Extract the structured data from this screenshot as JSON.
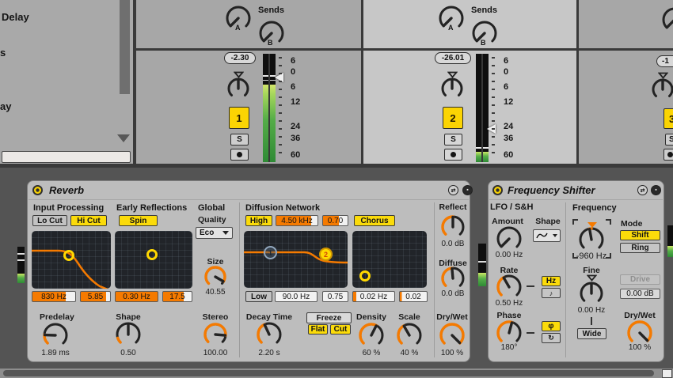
{
  "colors": {
    "accent_yellow": "#fbdb0a",
    "accent_orange": "#f57a00",
    "meter_green": "#55ad48",
    "selected_track": "#c7c7c7"
  },
  "browser": {
    "items": [
      "Delay",
      "s",
      "ay"
    ]
  },
  "mixer": {
    "sends_label": "Sends",
    "send_a": "A",
    "send_b": "B",
    "solo": "S",
    "meter_scale": [
      "6",
      "0",
      "6",
      "12",
      "24",
      "36",
      "60"
    ],
    "tracks": [
      {
        "number": "1",
        "volume": "-2.30"
      },
      {
        "number": "2",
        "volume": "-26.01"
      },
      {
        "number": "3",
        "volume": "-1"
      }
    ]
  },
  "reverb": {
    "title": "Reverb",
    "input_processing": {
      "label": "Input Processing",
      "lo_cut": "Lo Cut",
      "hi_cut": "Hi Cut",
      "freq": "830 Hz",
      "gain": "5.85"
    },
    "early_reflections": {
      "label": "Early Reflections",
      "spin": "Spin",
      "rate": "0.30 Hz",
      "amount": "17.5"
    },
    "global": {
      "label": "Global",
      "quality_label": "Quality",
      "quality": "Eco",
      "size_label": "Size",
      "size": "40.55",
      "stereo_label": "Stereo",
      "stereo": "100.00"
    },
    "diffusion": {
      "label": "Diffusion Network",
      "high": "High",
      "high_freq": "4.50 kHz",
      "high_gain": "0.70",
      "chorus": "Chorus",
      "marker1": "1",
      "marker2": "2",
      "low": "Low",
      "low_freq": "90.0 Hz",
      "low_gain": "0.75",
      "mod_rate": "0.02 Hz",
      "mod_amount": "0.02"
    },
    "reflect": {
      "label": "Reflect",
      "value": "0.0 dB"
    },
    "diffuse": {
      "label": "Diffuse",
      "value": "0.0 dB"
    },
    "predelay": {
      "label": "Predelay",
      "value": "1.89 ms"
    },
    "shape": {
      "label": "Shape",
      "value": "0.50"
    },
    "decay": {
      "label": "Decay Time",
      "value": "2.20 s"
    },
    "freeze": {
      "freeze": "Freeze",
      "flat": "Flat",
      "cut": "Cut"
    },
    "density": {
      "label": "Density",
      "value": "60 %"
    },
    "scale": {
      "label": "Scale",
      "value": "40 %"
    },
    "drywet": {
      "label": "Dry/Wet",
      "value": "100 %"
    }
  },
  "freq_shifter": {
    "title": "Frequency Shifter",
    "lfo": {
      "label": "LFO / S&H",
      "amount_label": "Amount",
      "amount": "0.00 Hz",
      "shape_label": "Shape",
      "rate_label": "Rate",
      "rate": "0.50 Hz",
      "hz": "Hz",
      "note_icon": "♪",
      "phase_label": "Phase",
      "phase": "180°",
      "phi": "φ",
      "spin_icon": "↻"
    },
    "frequency": {
      "label": "Frequency",
      "value": "-960 Hz",
      "fine_label": "Fine",
      "fine": "0.00 Hz",
      "wide": "Wide"
    },
    "mode": {
      "label": "Mode",
      "shift": "Shift",
      "ring": "Ring"
    },
    "drive": {
      "label": "Drive",
      "value": "0.00 dB"
    },
    "drywet": {
      "label": "Dry/Wet",
      "value": "100 %"
    }
  }
}
